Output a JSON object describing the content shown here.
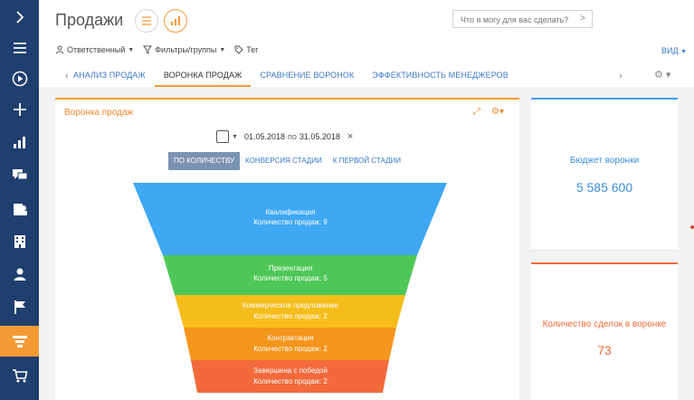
{
  "app": {
    "page_title": "Продажи",
    "search_placeholder": "Что я могу для вас сделать?"
  },
  "filters": {
    "responsible": "Ответственный",
    "filters_groups": "Фильтры/группы",
    "tag": "Тег",
    "view": "ВИД"
  },
  "tabs": [
    {
      "label": "АНАЛИЗ ПРОДАЖ"
    },
    {
      "label": "ВОРОНКА ПРОДАЖ"
    },
    {
      "label": "СРАВНЕНИЕ ВОРОНОК"
    },
    {
      "label": "ЭФФЕКТИВНОСТЬ МЕНЕДЖЕРОВ"
    }
  ],
  "funnel_widget": {
    "title": "Воронка продаж",
    "date_from": "01.05.2018",
    "date_sep": "по",
    "date_to": "31.05.2018",
    "modes": [
      "ПО КОЛИЧЕСТВУ",
      "КОНВЕРСИЯ СТАДИИ",
      "К ПЕРВОЙ СТАДИИ"
    ],
    "stages": [
      {
        "name": "Квалификация",
        "count_label": "Количество продаж: 9",
        "color": "#3ea8f4"
      },
      {
        "name": "Презентация",
        "count_label": "Количество продаж: 5",
        "color": "#4fc758"
      },
      {
        "name": "Коммерческое предложение",
        "count_label": "Количество продаж: 2",
        "color": "#f5bd1c"
      },
      {
        "name": "Контрактация",
        "count_label": "Количество продаж: 2",
        "color": "#f4951c"
      },
      {
        "name": "Завершена с победой",
        "count_label": "Количество продаж: 2",
        "color": "#f26a3c"
      }
    ]
  },
  "kpi": {
    "budget": {
      "label": "Бюджет воронки",
      "value": "5 585 600",
      "color": "#3b90dc"
    },
    "deals": {
      "label": "Количество сделок в воронке",
      "value": "73",
      "color": "#ef6a35"
    }
  },
  "colors": {
    "accent": "#f39a35",
    "rail": "#1f3f6e",
    "link": "#3b79c6"
  },
  "icons": {
    "rail": [
      "chevron-right-icon",
      "menu-icon",
      "play-icon",
      "plus-icon",
      "bar-chart-icon",
      "chat-icon",
      "contacts-icon",
      "building-icon",
      "user-icon",
      "flag-icon",
      "funnel-icon",
      "cart-icon"
    ]
  }
}
